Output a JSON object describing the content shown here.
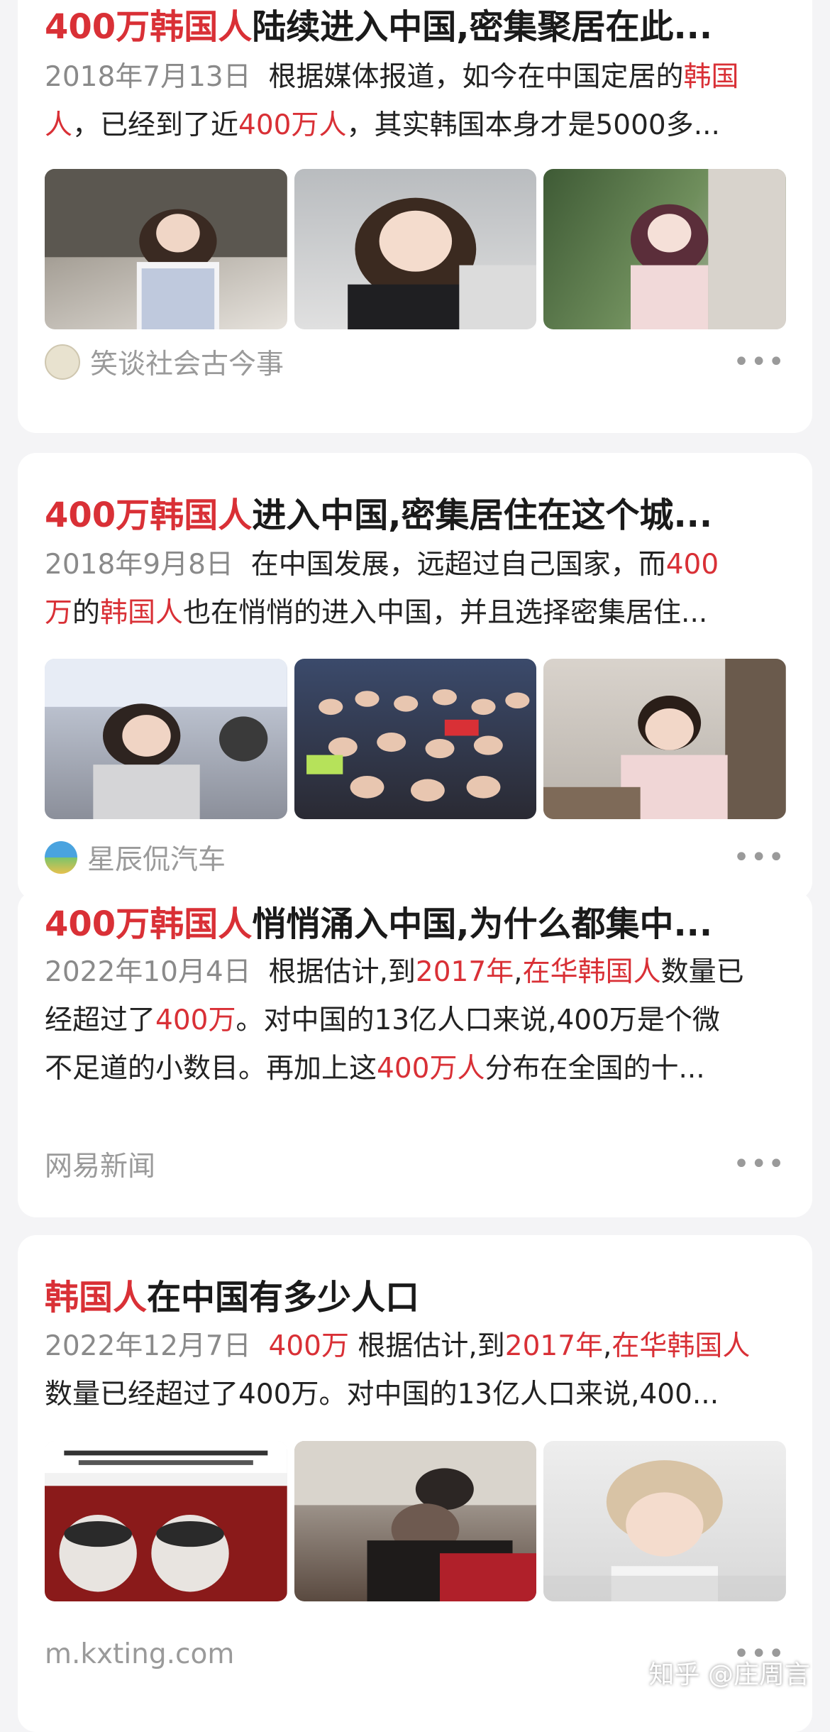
{
  "results": [
    {
      "title_hl": "400万韩国人",
      "title_rest": "陆续进入中国,密集聚居在此...",
      "date": "2018年7月13日",
      "line1": [
        {
          "t": "根据媒体报道，如今在中国定居的",
          "h": false
        },
        {
          "t": "韩国",
          "h": true
        }
      ],
      "line2": [
        {
          "t": "人",
          "h": true
        },
        {
          "t": "，已经到了近",
          "h": false
        },
        {
          "t": "400万人",
          "h": true
        },
        {
          "t": "，其实韩国本身才是5000多...",
          "h": false
        }
      ],
      "source": "笑谈社会古今事",
      "more": "•••"
    },
    {
      "title_hl": "400万韩国人",
      "title_rest": "进入中国,密集居住在这个城...",
      "date": "2018年9月8日",
      "line1": [
        {
          "t": "在中国发展，远超过自己国家，而",
          "h": false
        },
        {
          "t": "400",
          "h": true
        }
      ],
      "line2": [
        {
          "t": "万",
          "h": true
        },
        {
          "t": "的",
          "h": false
        },
        {
          "t": "韩国人",
          "h": true
        },
        {
          "t": "也在悄悄的进入中国，并且选择密集居住...",
          "h": false
        }
      ],
      "source": "星辰侃汽车",
      "more": "•••"
    },
    {
      "title_hl": "400万韩国人",
      "title_rest": "悄悄涌入中国,为什么都集中...",
      "date": "2022年10月4日",
      "line1": [
        {
          "t": "根据估计,到",
          "h": false
        },
        {
          "t": "2017年",
          "h": true
        },
        {
          "t": ",",
          "h": false
        },
        {
          "t": "在华韩国人",
          "h": true
        },
        {
          "t": "数量已",
          "h": false
        }
      ],
      "line2": [
        {
          "t": "经超过了",
          "h": false
        },
        {
          "t": "400万",
          "h": true
        },
        {
          "t": "。对中国的13亿人口来说,400万是个微",
          "h": false
        }
      ],
      "line3": [
        {
          "t": "不足道的小数目。再加上这",
          "h": false
        },
        {
          "t": "400万人",
          "h": true
        },
        {
          "t": "分布在全国的十...",
          "h": false
        }
      ],
      "source": "网易新闻",
      "more": "•••"
    },
    {
      "title_hl": "韩国人",
      "title_rest": "在中国有多少人口",
      "date": "2022年12月7日",
      "line1": [
        {
          "t": "400万",
          "h": true
        },
        {
          "t": " 根据估计,到",
          "h": false
        },
        {
          "t": "2017年",
          "h": true
        },
        {
          "t": ",",
          "h": false
        },
        {
          "t": "在华韩国人",
          "h": true
        }
      ],
      "line2": [
        {
          "t": "数量已经超过了400万。对中国的13亿人口来说,400...",
          "h": false
        }
      ],
      "source": "m.kxting.com",
      "more": "•••"
    }
  ],
  "watermark": "知乎 @庄周言",
  "accent_color": "#d93036"
}
